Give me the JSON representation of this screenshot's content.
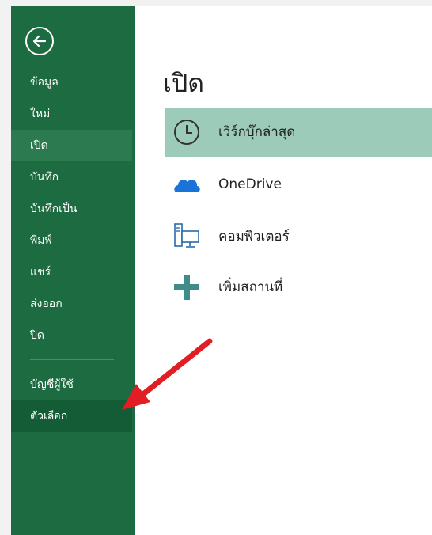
{
  "sidebar": {
    "items": [
      {
        "label": "ข้อมูล"
      },
      {
        "label": "ใหม่"
      },
      {
        "label": "เปิด"
      },
      {
        "label": "บันทึก"
      },
      {
        "label": "บันทึกเป็น"
      },
      {
        "label": "พิมพ์"
      },
      {
        "label": "แชร์"
      },
      {
        "label": "ส่งออก"
      },
      {
        "label": "ปิด"
      },
      {
        "label": "บัญชีผู้ใช้"
      },
      {
        "label": "ตัวเลือก"
      }
    ],
    "selected_item": "เปิด",
    "accent_color": "#1d6b41"
  },
  "main": {
    "title": "เปิด",
    "locations": [
      {
        "label": "เวิร์กบุ๊กล่าสุด",
        "icon": "clock-icon"
      },
      {
        "label": "OneDrive",
        "icon": "cloud-icon"
      },
      {
        "label": "คอมพิวเตอร์",
        "icon": "computer-icon"
      },
      {
        "label": "เพิ่มสถานที่",
        "icon": "plus-icon"
      }
    ],
    "selected_location": "เวิร์กบุ๊กล่าสุด"
  },
  "annotation": {
    "arrow_color": "#e01e24",
    "points_to": "ตัวเลือก"
  }
}
